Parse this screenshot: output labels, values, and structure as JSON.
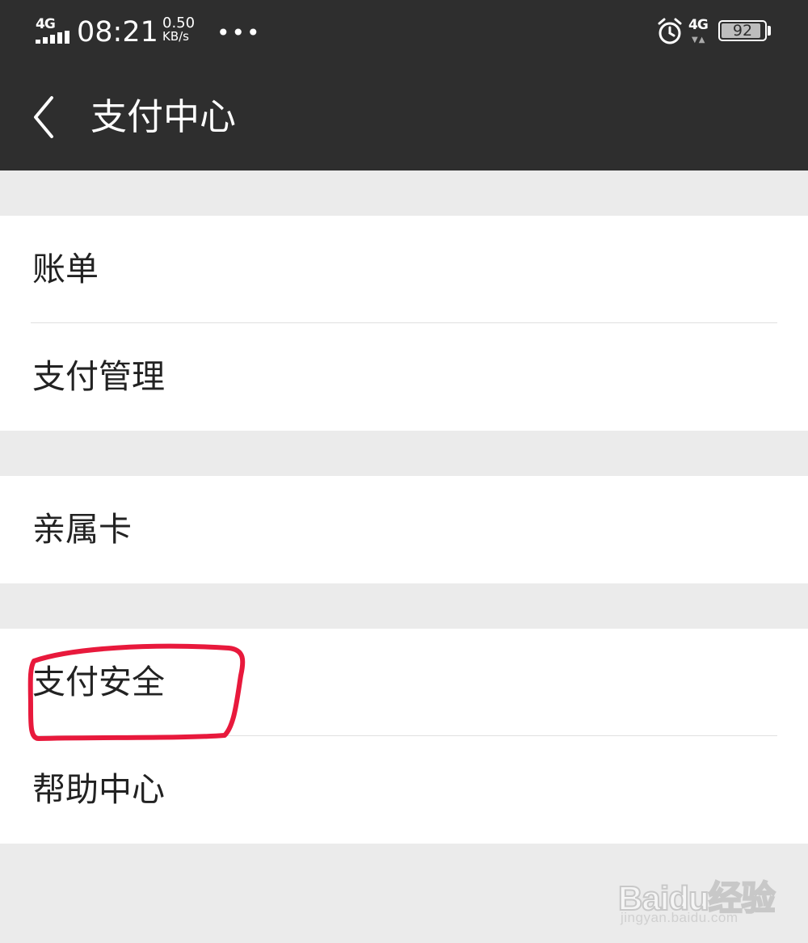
{
  "status_bar": {
    "signal_label": "4G",
    "time": "08:21",
    "speed_value": "0.50",
    "speed_unit": "KB/s",
    "more": "•••",
    "network_label": "4G",
    "battery": "92",
    "battery_level_percent": 92
  },
  "header": {
    "title": "支付中心"
  },
  "groups": [
    {
      "items": [
        {
          "label": "账单"
        },
        {
          "label": "支付管理"
        }
      ]
    },
    {
      "items": [
        {
          "label": "亲属卡"
        }
      ]
    },
    {
      "items": [
        {
          "label": "支付安全"
        },
        {
          "label": "帮助中心"
        }
      ]
    }
  ],
  "annotation": {
    "color": "#e8193c",
    "circled_item": "支付安全"
  },
  "watermark": {
    "logo": "Baidu经验",
    "url": "jingyan.baidu.com"
  },
  "colors": {
    "topbar": "#2e2e2e",
    "background": "#ebebeb",
    "card": "#ffffff"
  }
}
